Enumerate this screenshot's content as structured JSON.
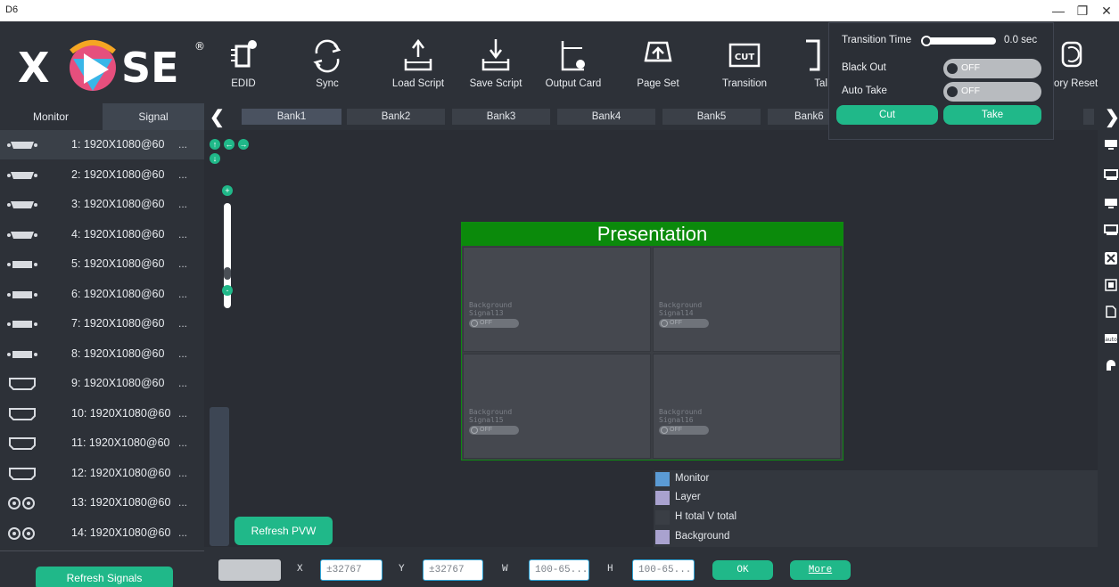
{
  "window": {
    "title": "D6",
    "min_glyph": "—",
    "max_glyph": "❐",
    "close_glyph": "✕"
  },
  "logo": {
    "text": "XPOSE",
    "mark": "®"
  },
  "toolbar": {
    "edid": "EDID",
    "sync": "Sync",
    "load_script": "Load Script",
    "save_script": "Save Script",
    "output_card": "Output Card",
    "page_set": "Page Set",
    "transition": "Transition",
    "transition_icon_text": "CUT",
    "take_partial": "Tal",
    "factory_reset_partial": "ory Reset"
  },
  "left_tabs": {
    "monitor": "Monitor",
    "signal": "Signal"
  },
  "signals": [
    {
      "label": "1: 1920X1080@60",
      "more": "...",
      "icon": "vga-icon"
    },
    {
      "label": "2: 1920X1080@60",
      "more": "...",
      "icon": "vga-icon"
    },
    {
      "label": "3: 1920X1080@60",
      "more": "...",
      "icon": "vga-icon"
    },
    {
      "label": "4: 1920X1080@60",
      "more": "...",
      "icon": "vga-icon"
    },
    {
      "label": "5: 1920X1080@60",
      "more": "...",
      "icon": "dvi-icon"
    },
    {
      "label": "6: 1920X1080@60",
      "more": "...",
      "icon": "dvi-icon"
    },
    {
      "label": "7: 1920X1080@60",
      "more": "...",
      "icon": "dvi-icon"
    },
    {
      "label": "8: 1920X1080@60",
      "more": "...",
      "icon": "dvi-icon"
    },
    {
      "label": "9: 1920X1080@60",
      "more": "...",
      "icon": "hdmi-icon"
    },
    {
      "label": "10: 1920X1080@60",
      "more": "...",
      "icon": "hdmi-icon"
    },
    {
      "label": "11: 1920X1080@60",
      "more": "...",
      "icon": "hdmi-icon"
    },
    {
      "label": "12: 1920X1080@60",
      "more": "...",
      "icon": "hdmi-icon"
    },
    {
      "label": "13: 1920X1080@60",
      "more": "...",
      "icon": "sdi-icon"
    },
    {
      "label": "14: 1920X1080@60",
      "more": "...",
      "icon": "sdi-icon"
    }
  ],
  "refresh_signals": "Refresh Signals",
  "banks": [
    "Bank1",
    "Bank2",
    "Bank3",
    "Bank4",
    "Bank5",
    "Bank6"
  ],
  "nav": {
    "prev": "❮",
    "next": "❯"
  },
  "canvas": {
    "zoom_in": "+",
    "zoom_out": "-",
    "refresh_pvw": "Refresh PVW",
    "move_glyphs": {
      "up": "↑",
      "left": "←",
      "right": "→",
      "down": "↓"
    }
  },
  "screen": {
    "title": "Presentation",
    "cells": [
      {
        "line1": "Background",
        "line2": "Signal13",
        "toggle": "OFF"
      },
      {
        "line1": "Background",
        "line2": "Signal14",
        "toggle": "OFF"
      },
      {
        "line1": "Background",
        "line2": "Signal15",
        "toggle": "OFF"
      },
      {
        "line1": "Background",
        "line2": "Signal16",
        "toggle": "OFF"
      }
    ]
  },
  "legend": [
    {
      "label": "Monitor",
      "color": "#5b9bd5"
    },
    {
      "label": "Layer",
      "color": "#a9a2cf"
    },
    {
      "label": "H total V total",
      "color": "#3a3e45"
    },
    {
      "label": "Background",
      "color": "#a9a2cf"
    }
  ],
  "bottom": {
    "x_label": "X",
    "x_value": "±32767",
    "y_label": "Y",
    "y_value": "±32767",
    "w_label": "W",
    "w_value": "100-65...",
    "h_label": "H",
    "h_value": "100-65...",
    "ok": "OK",
    "more": "More"
  },
  "popup": {
    "transition_time_label": "Transition Time",
    "transition_time_value": "0.0 sec",
    "transition_time_level": 0,
    "black_out_label": "Black Out",
    "black_out_state": "OFF",
    "auto_take_label": "Auto Take",
    "auto_take_state": "OFF",
    "cut": "Cut",
    "take": "Take"
  },
  "colors": {
    "accent": "#20b889",
    "screen_header": "#0b8a0b",
    "background": "#2b2f36",
    "selected_row": "#3a4048"
  }
}
